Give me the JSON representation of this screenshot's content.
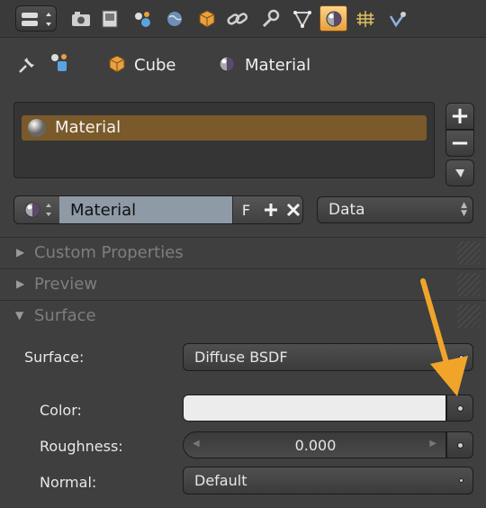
{
  "context": {
    "object_name": "Cube",
    "material_name": "Material"
  },
  "material_slots": {
    "items": [
      {
        "label": "Material"
      }
    ],
    "add_label": "+",
    "remove_label": "−"
  },
  "id_block": {
    "name_value": "Material",
    "fake_user_label": "F",
    "link_selector": "Data"
  },
  "panels": [
    {
      "title": "Custom Properties",
      "expanded": false
    },
    {
      "title": "Preview",
      "expanded": false
    },
    {
      "title": "Surface",
      "expanded": true
    }
  ],
  "surface": {
    "surface_label": "Surface:",
    "surface_value": "Diffuse BSDF",
    "color_label": "Color:",
    "roughness_label": "Roughness:",
    "roughness_value": "0.000",
    "normal_label": "Normal:",
    "normal_value": "Default"
  },
  "colors": {
    "active_tab": "#e69f3c",
    "selected_row": "#7a5a2a",
    "name_field": "#8e9aa6",
    "color_swatch": "#ececec",
    "annotation_arrow": "#f0a52a"
  },
  "tabs": [
    "render-icon",
    "render-layers-icon",
    "scene-icon",
    "world-icon",
    "object-icon",
    "constraints-icon",
    "modifiers-icon",
    "data-icon",
    "material-icon",
    "texture-icon",
    "particles-icon"
  ]
}
